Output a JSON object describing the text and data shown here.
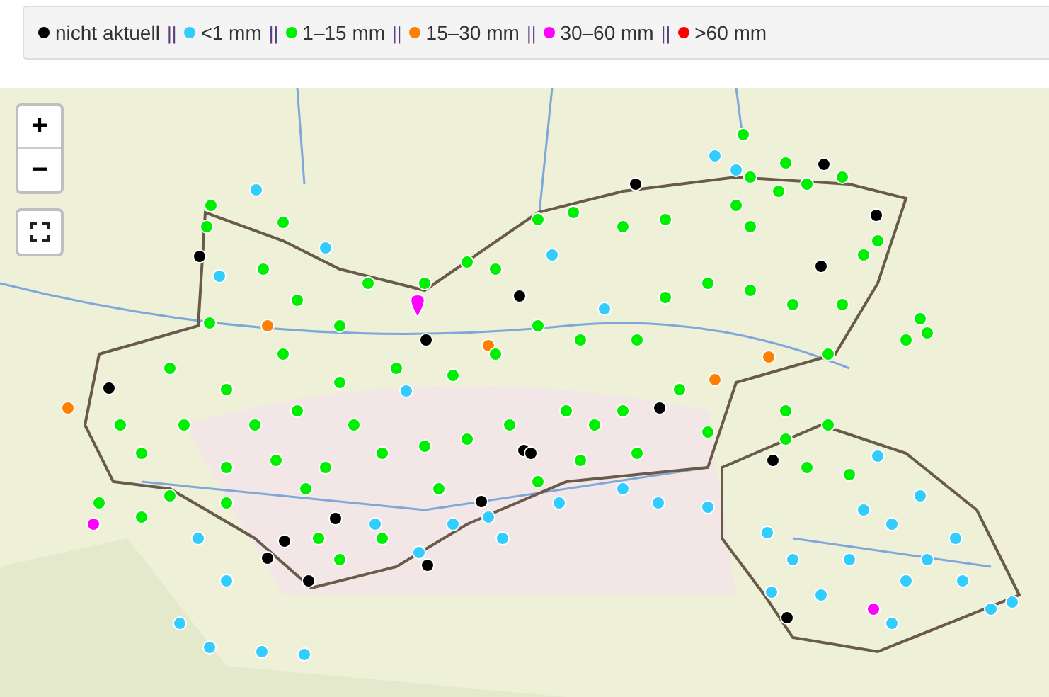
{
  "legend": [
    {
      "label": "nicht aktuell",
      "color": "#000000",
      "separator": "||"
    },
    {
      "label": "<1 mm",
      "color": "#33ccff",
      "separator": "||"
    },
    {
      "label": "1–15 mm",
      "color": "#00ee00",
      "separator": "||"
    },
    {
      "label": "15–30 mm",
      "color": "#ff8000",
      "separator": "||"
    },
    {
      "label": "30–60 mm",
      "color": "#ff00ff",
      "separator": "||"
    },
    {
      "label": ">60 mm",
      "color": "#ff0000"
    }
  ],
  "map": {
    "zoom_in": "+",
    "zoom_out": "−"
  }
}
